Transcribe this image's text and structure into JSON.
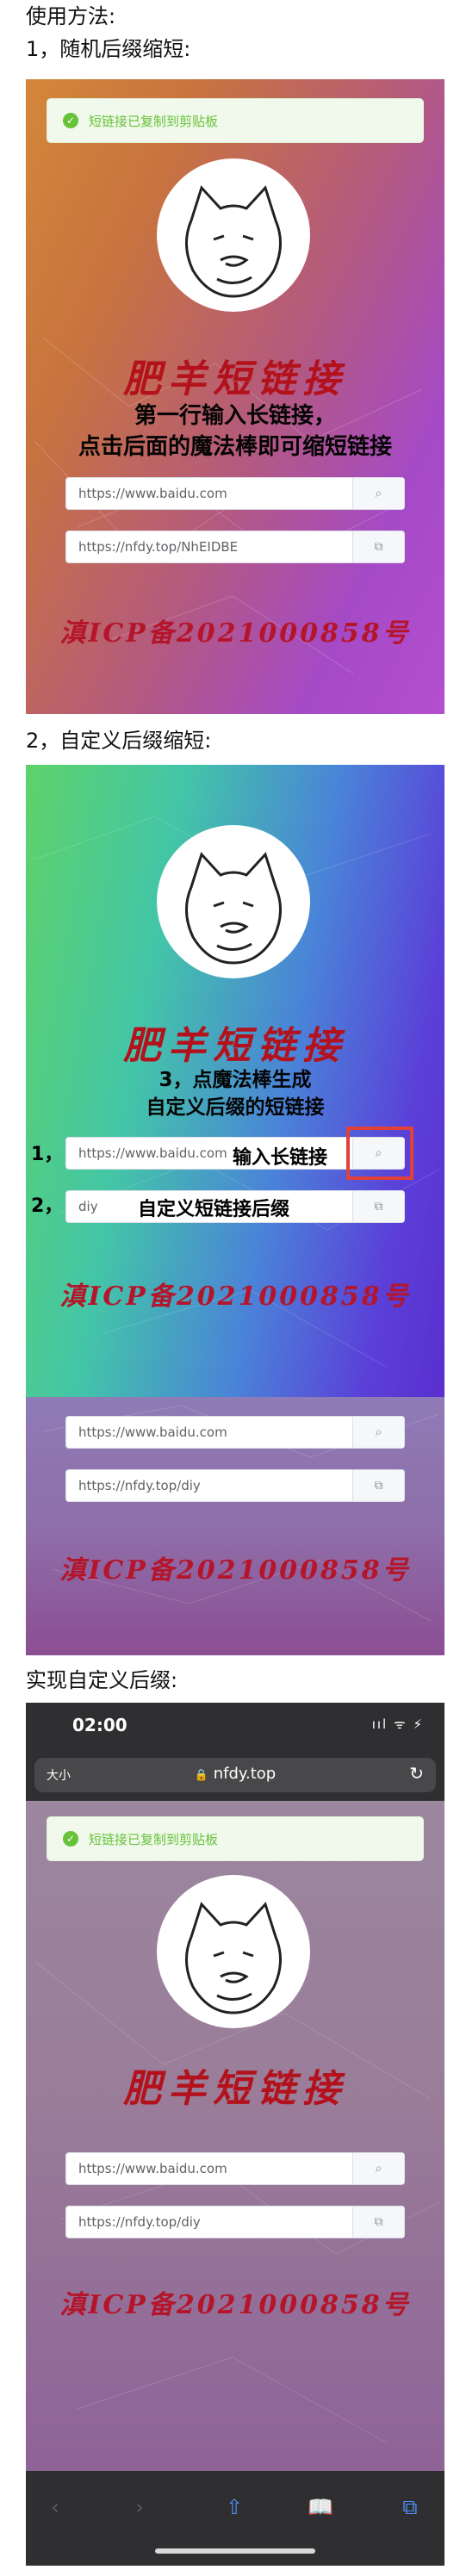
{
  "section1": {
    "title": "使用方法:",
    "subtitle": "1，随机后缀缩短:"
  },
  "section2": {
    "title": "2，自定义后缀缩短:"
  },
  "section3": {
    "title": "实现自定义后缀:"
  },
  "toast": {
    "message": "短链接已复制到剪贴板"
  },
  "brand": {
    "name": "肥羊短链接",
    "icp": "滇ICP备2021000858号"
  },
  "shot1": {
    "caption_line1": "第一行输入长链接，",
    "caption_line2": "点击后面的魔法棒即可缩短链接",
    "long_url": "https://www.baidu.com",
    "short_url": "https://nfdy.top/NhEIDBE"
  },
  "shot2": {
    "caption_line1": "3，点魔法棒生成",
    "caption_line2": "自定义后缀的短链接",
    "step1_number": "1，",
    "step1_label": "输入长链接",
    "step2_number": "2，",
    "step2_label": "自定义短链接后缀",
    "long_url": "https://www.baidu.com",
    "suffix": "diy"
  },
  "shot2b": {
    "long_url": "https://www.baidu.com",
    "short_url": "https://nfdy.top/diy"
  },
  "phone": {
    "time": "02:00",
    "status_icons": "ııl ᯤ ⚡",
    "text_size": "大小",
    "url": "nfdy.top",
    "long_url": "https://www.baidu.com",
    "short_url": "https://nfdy.top/diy",
    "toolbar": {
      "back": "‹",
      "forward": "›",
      "share": "⇧",
      "bookmarks": "📖",
      "tabs": "⧉"
    }
  },
  "icons": {
    "magic_wand": "⌕",
    "copy": "⧉",
    "check": "✓",
    "lock": "🔒",
    "reload": "↻"
  }
}
